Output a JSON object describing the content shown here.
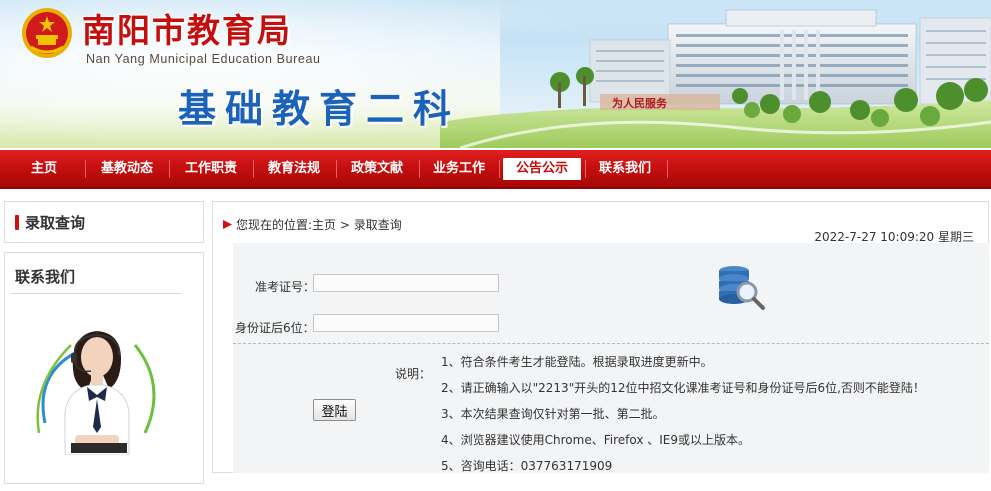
{
  "header": {
    "site_title": "南阳市教育局",
    "site_subtitle": "Nan Yang Municipal Education Bureau",
    "department_title": "基础教育二科"
  },
  "nav": {
    "items": [
      {
        "label": "主页"
      },
      {
        "label": "基教动态"
      },
      {
        "label": "工作职责"
      },
      {
        "label": "教育法规"
      },
      {
        "label": "政策文献"
      },
      {
        "label": "业务工作"
      },
      {
        "label": "公告公示",
        "active": true
      },
      {
        "label": "联系我们"
      }
    ]
  },
  "sidebar": {
    "query_heading": "录取查询",
    "contact_heading": "联系我们"
  },
  "main": {
    "breadcrumb": "您现在的位置:主页 > 录取查询",
    "datetime": "2022-7-27 10:09:20 星期三"
  },
  "form": {
    "exam_id_label": "准考证号：",
    "exam_id_value": "",
    "id_last6_label": "身份证后6位：",
    "id_last6_value": "",
    "login_label": "登陆"
  },
  "notes": {
    "label": "说明：",
    "items": [
      "1、符合条件考生才能登陆。根据录取进度更新中。",
      "2、请正确输入以\"2213\"开头的12位中招文化课准考证号和身份证号后6位,否则不能登陆！",
      "3、本次结果查询仅针对第一批、第二批。",
      "4、浏览器建议使用Chrome、Firefox 、IE9或以上版本。",
      "5、咨询电话：037763171909"
    ]
  },
  "colors": {
    "nav_red": "#c00d0d",
    "title_red": "#c40f0f",
    "title_blue": "#1a63b8"
  }
}
